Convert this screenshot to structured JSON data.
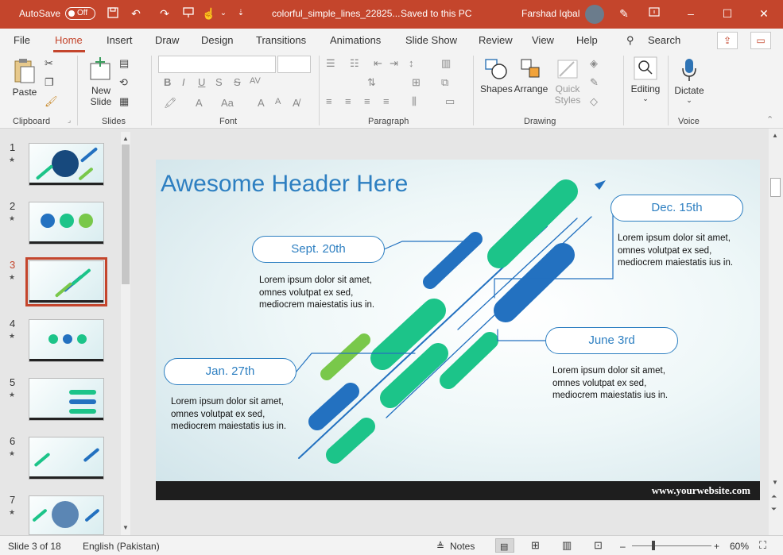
{
  "titlebar": {
    "autosave_label": "AutoSave",
    "autosave_state": "Off",
    "doc_title": "colorful_simple_lines_22825...",
    "save_status": "Saved to this PC",
    "user_name": "Farshad Iqbal",
    "bg_color": "#c4452c"
  },
  "tabs": [
    "File",
    "Home",
    "Insert",
    "Draw",
    "Design",
    "Transitions",
    "Animations",
    "Slide Show",
    "Review",
    "View",
    "Help"
  ],
  "search_label": "Search",
  "ribbon": {
    "clipboard": {
      "paste": "Paste",
      "group": "Clipboard"
    },
    "slides": {
      "new_slide_1": "New",
      "new_slide_2": "Slide",
      "group": "Slides"
    },
    "font": {
      "group": "Font",
      "bold": "B",
      "italic": "I",
      "underline": "U",
      "strike": "S",
      "spacing": "AV",
      "case": "Aa",
      "grow": "A",
      "shrink": "A"
    },
    "paragraph": {
      "group": "Paragraph"
    },
    "drawing": {
      "shapes": "Shapes",
      "arrange": "Arrange",
      "quick_styles_1": "Quick",
      "quick_styles_2": "Styles",
      "group": "Drawing"
    },
    "editing": {
      "label": "Editing"
    },
    "voice": {
      "dictate": "Dictate",
      "group": "Voice"
    }
  },
  "slides_panel": [
    {
      "num": "1",
      "active": false
    },
    {
      "num": "2",
      "active": false
    },
    {
      "num": "3",
      "active": true
    },
    {
      "num": "4",
      "active": false
    },
    {
      "num": "5",
      "active": false
    },
    {
      "num": "6",
      "active": false
    },
    {
      "num": "7",
      "active": false
    }
  ],
  "slide": {
    "title": "Awesome Header Here",
    "milestones": [
      {
        "date": "Sept. 20th",
        "text": [
          "Lorem ipsum dolor sit amet,",
          "omnes volutpat ex sed,",
          "mediocrem maiestatis ius in."
        ]
      },
      {
        "date": "Dec. 15th",
        "text": [
          "Lorem ipsum dolor sit amet,",
          "omnes volutpat ex sed,",
          "mediocrem maiestatis ius in."
        ]
      },
      {
        "date": "June 3rd",
        "text": [
          "Lorem ipsum dolor sit amet,",
          "omnes volutpat ex sed,",
          "mediocrem maiestatis ius in."
        ]
      },
      {
        "date": "Jan. 27th",
        "text": [
          "Lorem ipsum dolor sit amet,",
          "omnes volutpat ex sed,",
          "mediocrem maiestatis ius in."
        ]
      }
    ],
    "website": "www.yourwebsite.com",
    "colors": {
      "blue": "#2371c0",
      "green": "#1cc489",
      "lime": "#79c84a",
      "accent": "#2d7fc1"
    }
  },
  "status": {
    "slide_info": "Slide 3 of 18",
    "language": "English (Pakistan)",
    "notes": "Notes",
    "zoom": "60%"
  }
}
